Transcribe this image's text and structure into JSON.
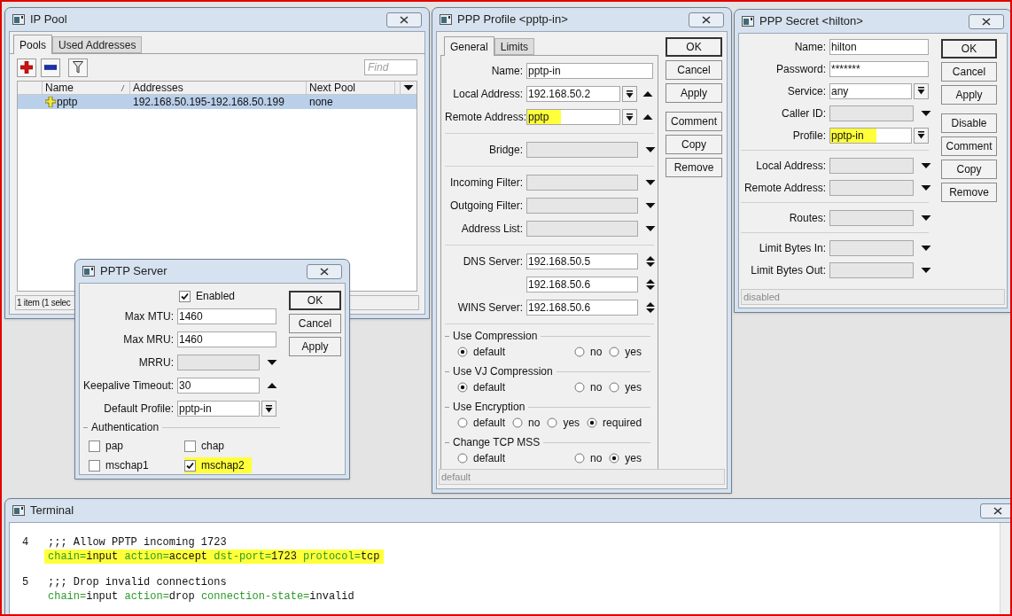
{
  "ip_pool": {
    "title": "IP Pool",
    "tabs": [
      {
        "label": "Pools",
        "selected": true
      },
      {
        "label": "Used Addresses",
        "selected": false
      }
    ],
    "find": {
      "placeholder": "Find"
    },
    "table": {
      "columns": [
        "Name",
        "Addresses",
        "Next Pool"
      ],
      "rows": [
        {
          "cells": [
            "pptp",
            "192.168.50.195-192.168.50.199",
            "none"
          ],
          "selected": true
        }
      ]
    },
    "status_bar": "1 item (1 selec"
  },
  "ppp_profile": {
    "title": "PPP Profile <pptp-in>",
    "tabs": [
      {
        "label": "General",
        "selected": true
      },
      {
        "label": "Limits",
        "selected": false
      }
    ],
    "fields": [
      {
        "kind": "text",
        "label": "Name:",
        "value": "pptp-in"
      },
      {
        "kind": "select-up",
        "label": "Local Address:",
        "value": "192.168.50.2"
      },
      {
        "kind": "select-up",
        "label": "Remote Address:",
        "value": "pptp",
        "highlighted": true
      },
      {
        "kind": "separator"
      },
      {
        "kind": "dropdown",
        "label": "Bridge:"
      },
      {
        "kind": "separator"
      },
      {
        "kind": "dropdown",
        "label": "Incoming Filter:"
      },
      {
        "kind": "dropdown",
        "label": "Outgoing Filter:"
      },
      {
        "kind": "dropdown",
        "label": "Address List:"
      },
      {
        "kind": "separator"
      },
      {
        "kind": "updown",
        "label": "DNS Server:",
        "value": "192.168.50.5"
      },
      {
        "kind": "updown",
        "value": "192.168.50.6"
      },
      {
        "kind": "updown",
        "label": "WINS Server:",
        "value": "192.168.50.6"
      },
      {
        "kind": "separator"
      }
    ],
    "radio_groups": [
      {
        "label": "Use Compression",
        "options": [
          {
            "label": "default",
            "selected": true
          },
          {
            "label": "no",
            "selected": false
          },
          {
            "label": "yes",
            "selected": false
          }
        ]
      },
      {
        "label": "Use VJ Compression",
        "options": [
          {
            "label": "default",
            "selected": true
          },
          {
            "label": "no",
            "selected": false
          },
          {
            "label": "yes",
            "selected": false
          }
        ]
      },
      {
        "label": "Use Encryption",
        "options": [
          {
            "label": "default",
            "selected": false
          },
          {
            "label": "no",
            "selected": false
          },
          {
            "label": "yes",
            "selected": false
          },
          {
            "label": "required",
            "selected": true
          }
        ]
      },
      {
        "label": "Change TCP MSS",
        "options": [
          {
            "label": "default",
            "selected": false
          },
          {
            "label": "no",
            "selected": false
          },
          {
            "label": "yes",
            "selected": true
          }
        ]
      }
    ],
    "buttons": [
      {
        "label": "OK",
        "default": true
      },
      {
        "label": "Cancel",
        "default": false
      },
      {
        "label": "Apply",
        "default": false
      },
      {
        "label": "Comment",
        "default": false
      },
      {
        "label": "Copy",
        "default": false
      },
      {
        "label": "Remove",
        "default": false
      }
    ],
    "status_bar": "default"
  },
  "ppp_secret": {
    "title": "PPP Secret <hilton>",
    "fields": [
      {
        "kind": "text",
        "label": "Name:",
        "value": "hilton"
      },
      {
        "kind": "text",
        "label": "Password:",
        "value": "*******"
      },
      {
        "kind": "select",
        "label": "Service:",
        "value": "any"
      },
      {
        "kind": "dropdown",
        "label": "Caller ID:"
      },
      {
        "kind": "select",
        "label": "Profile:",
        "value": "pptp-in",
        "highlighted": true
      },
      {
        "kind": "separator"
      },
      {
        "kind": "dropdown",
        "label": "Local Address:"
      },
      {
        "kind": "dropdown",
        "label": "Remote Address:"
      },
      {
        "kind": "separator"
      },
      {
        "kind": "dropdown",
        "label": "Routes:"
      },
      {
        "kind": "separator"
      },
      {
        "kind": "dropdown",
        "label": "Limit Bytes In:"
      },
      {
        "kind": "dropdown",
        "label": "Limit Bytes Out:"
      }
    ],
    "buttons": [
      {
        "label": "OK",
        "default": true
      },
      {
        "label": "Cancel",
        "default": false
      },
      {
        "label": "Apply",
        "default": false
      },
      {
        "label": "Disable",
        "default": false
      },
      {
        "label": "Comment",
        "default": false
      },
      {
        "label": "Copy",
        "default": false
      },
      {
        "label": "Remove",
        "default": false
      }
    ],
    "status_bar": "disabled"
  },
  "pptp_server": {
    "title": "PPTP Server",
    "enabled": {
      "label": "Enabled",
      "checked": true
    },
    "fields": [
      {
        "kind": "text",
        "label": "Max MTU:",
        "value": "1460"
      },
      {
        "kind": "text",
        "label": "Max MRU:",
        "value": "1460"
      },
      {
        "kind": "dropdown",
        "label": "MRRU:"
      },
      {
        "kind": "up",
        "label": "Keepalive Timeout:",
        "value": "30"
      },
      {
        "kind": "select",
        "label": "Default Profile:",
        "value": "pptp-in"
      }
    ],
    "authentication": {
      "label": "Authentication",
      "options": [
        {
          "label": "pap",
          "checked": false,
          "highlighted": false
        },
        {
          "label": "chap",
          "checked": false,
          "highlighted": false
        },
        {
          "label": "mschap1",
          "checked": false,
          "highlighted": false
        },
        {
          "label": "mschap2",
          "checked": true,
          "highlighted": true
        }
      ]
    },
    "buttons": [
      {
        "label": "OK",
        "default": true
      },
      {
        "label": "Cancel",
        "default": false
      },
      {
        "label": "Apply",
        "default": false
      }
    ]
  },
  "terminal": {
    "title": "Terminal",
    "rules": [
      {
        "number": "4",
        "comment": ";;; Allow PPTP incoming 1723",
        "highlighted": true,
        "params": [
          {
            "key": "chain=",
            "value": "input"
          },
          {
            "key": "action=",
            "value": "accept"
          },
          {
            "key": "dst-port=",
            "value": "1723"
          },
          {
            "key": "protocol=",
            "value": "tcp"
          }
        ]
      },
      {
        "number": "5",
        "comment": ";;; Drop invalid connections",
        "highlighted": false,
        "params": [
          {
            "key": "chain=",
            "value": "input"
          },
          {
            "key": "action=",
            "value": "drop"
          },
          {
            "key": "connection-state=",
            "value": "invalid"
          }
        ]
      }
    ]
  }
}
